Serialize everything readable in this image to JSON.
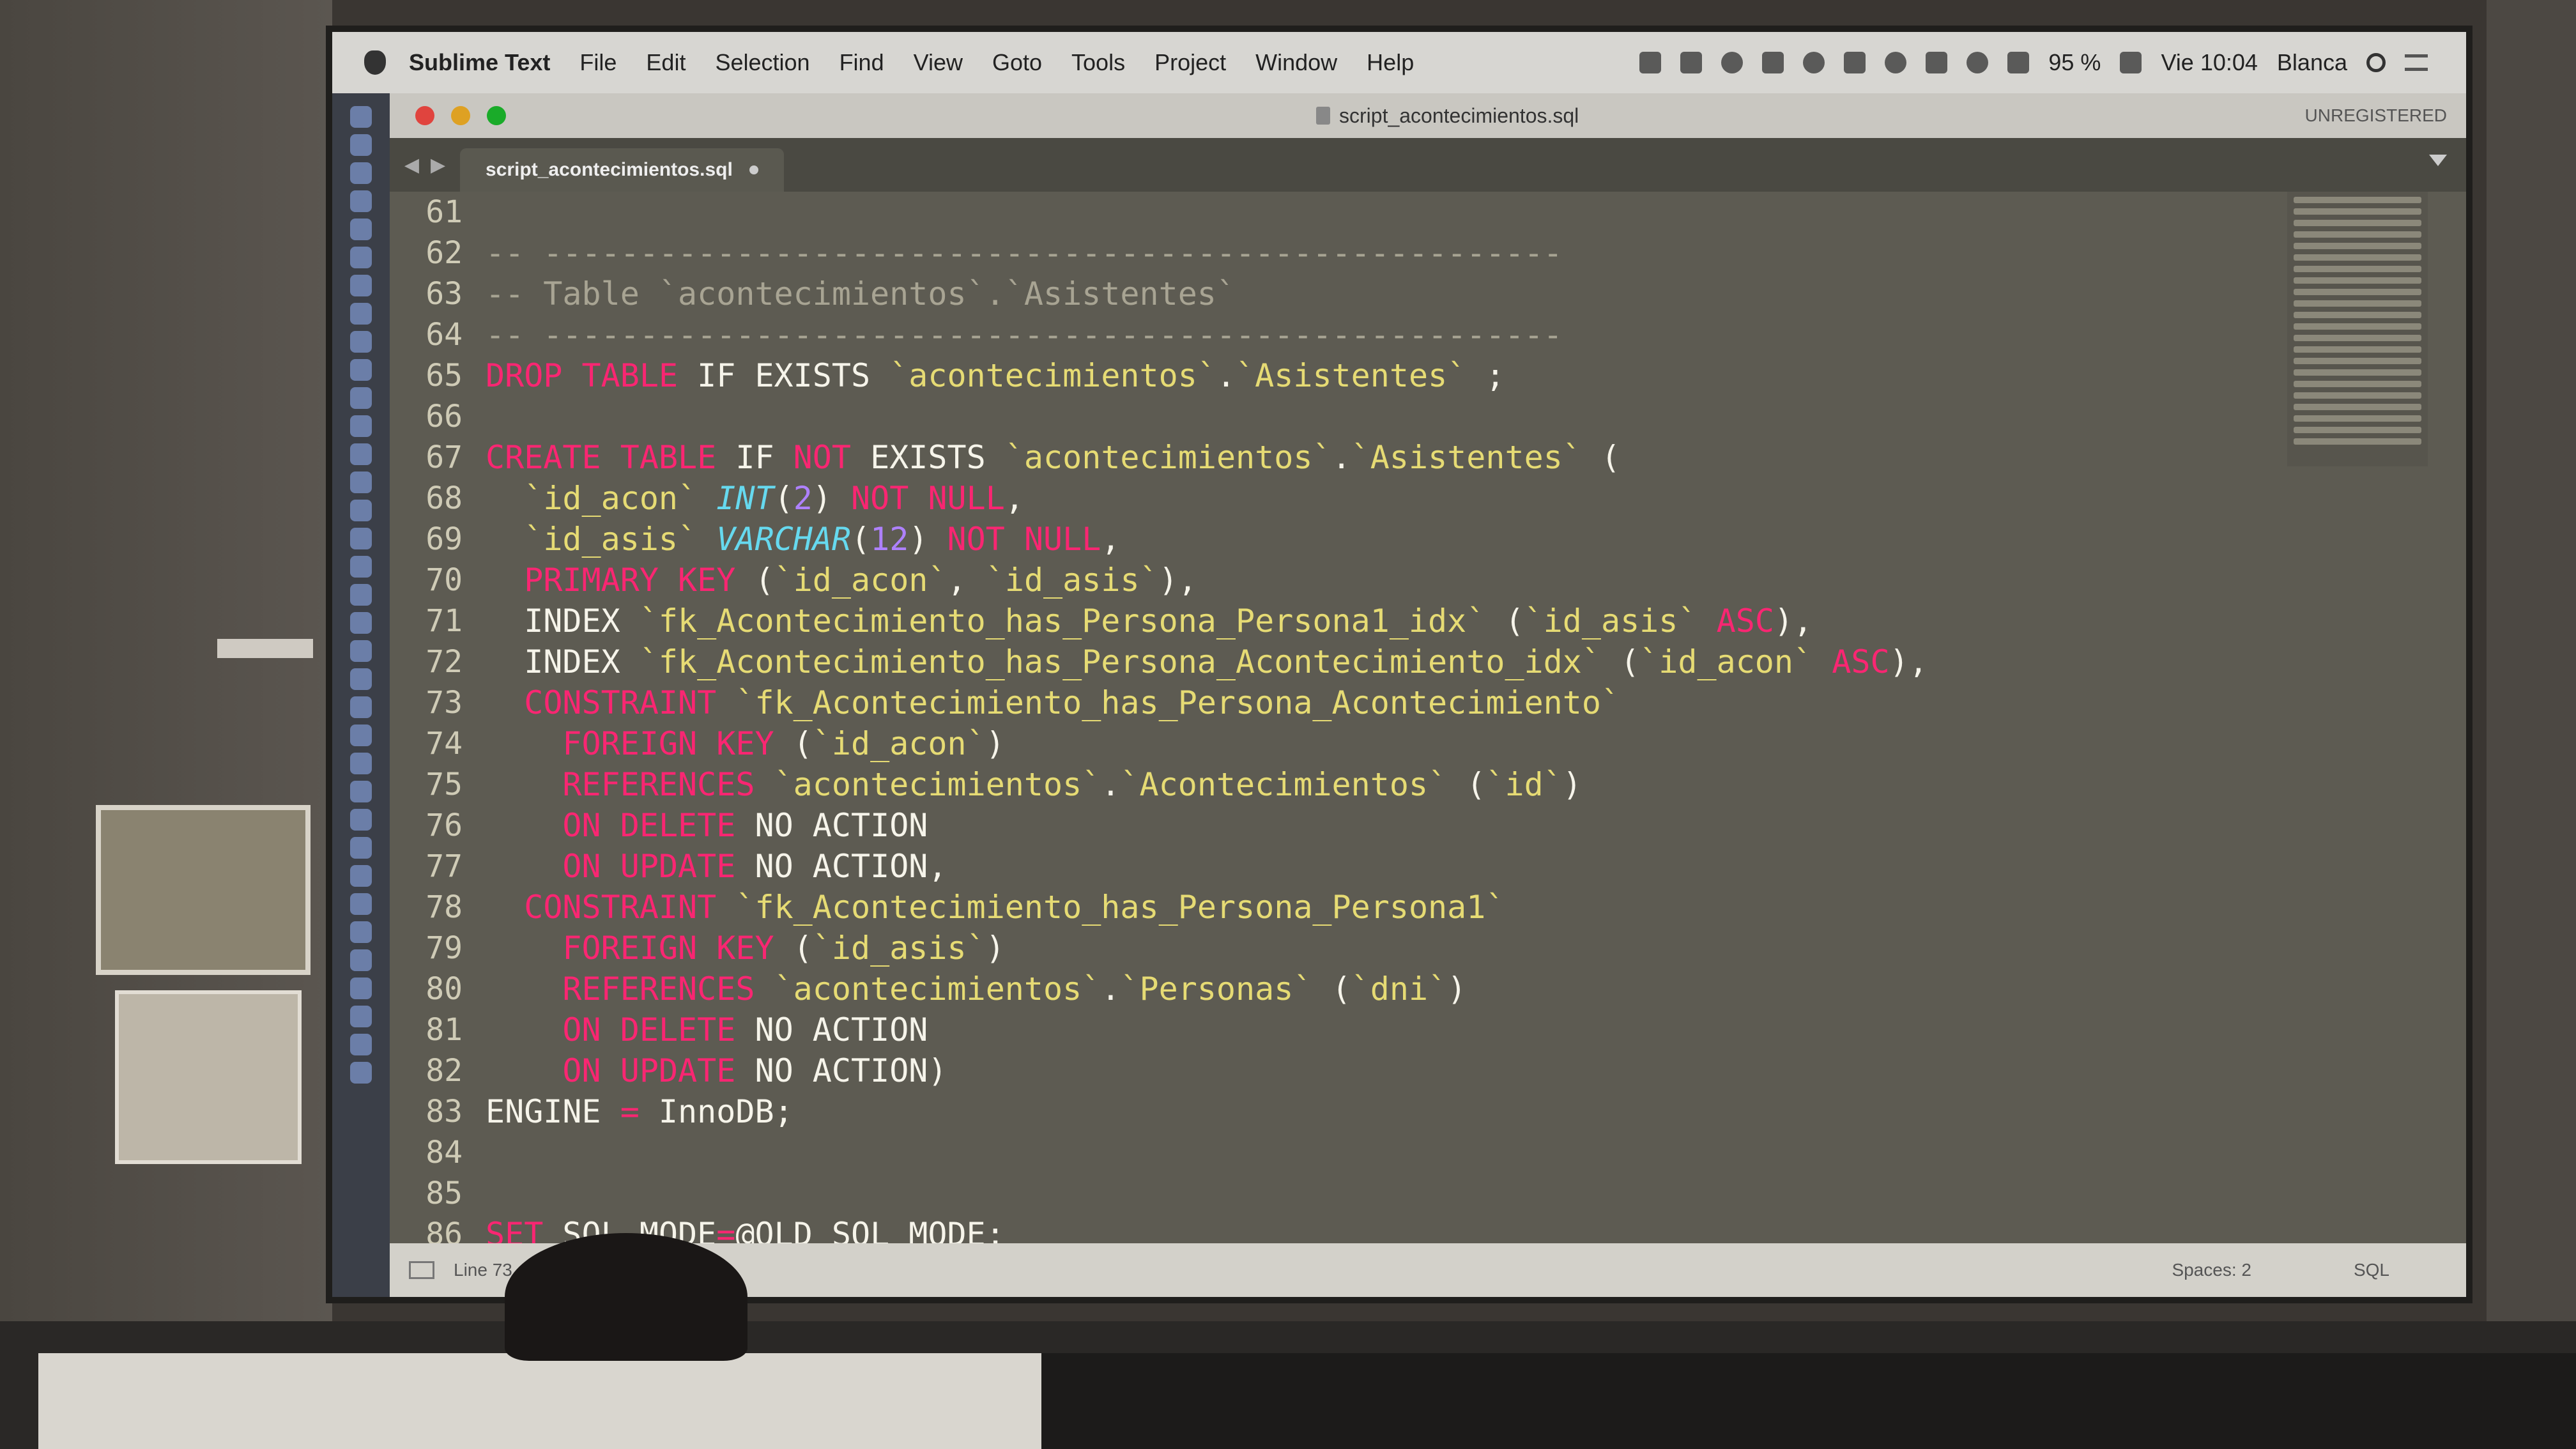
{
  "menubar": {
    "app_name": "Sublime Text",
    "menus": [
      "File",
      "Edit",
      "Selection",
      "Find",
      "View",
      "Goto",
      "Tools",
      "Project",
      "Window",
      "Help"
    ],
    "battery": "95 %",
    "clock": "Vie 10:04",
    "user": "Blanca"
  },
  "window": {
    "title": "script_acontecimientos.sql",
    "registration": "UNREGISTERED"
  },
  "tab": {
    "label": "script_acontecimientos.sql"
  },
  "editor": {
    "lines": [
      {
        "num": "61",
        "text": ""
      },
      {
        "num": "62",
        "text": "-- -----------------------------------------------------"
      },
      {
        "num": "63",
        "text": "-- Table `acontecimientos`.`Asistentes`"
      },
      {
        "num": "64",
        "text": "-- -----------------------------------------------------"
      },
      {
        "num": "65",
        "text": "DROP TABLE IF EXISTS `acontecimientos`.`Asistentes` ;"
      },
      {
        "num": "66",
        "text": ""
      },
      {
        "num": "67",
        "text": "CREATE TABLE IF NOT EXISTS `acontecimientos`.`Asistentes` ("
      },
      {
        "num": "68",
        "text": "  `id_acon` INT(2) NOT NULL,"
      },
      {
        "num": "69",
        "text": "  `id_asis` VARCHAR(12) NOT NULL,"
      },
      {
        "num": "70",
        "text": "  PRIMARY KEY (`id_acon`, `id_asis`),"
      },
      {
        "num": "71",
        "text": "  INDEX `fk_Acontecimiento_has_Persona_Persona1_idx` (`id_asis` ASC),"
      },
      {
        "num": "72",
        "text": "  INDEX `fk_Acontecimiento_has_Persona_Acontecimiento_idx` (`id_acon` ASC),"
      },
      {
        "num": "73",
        "text": "  CONSTRAINT `fk_Acontecimiento_has_Persona_Acontecimiento`"
      },
      {
        "num": "74",
        "text": "    FOREIGN KEY (`id_acon`)"
      },
      {
        "num": "75",
        "text": "    REFERENCES `acontecimientos`.`Acontecimientos` (`id`)"
      },
      {
        "num": "76",
        "text": "    ON DELETE NO ACTION"
      },
      {
        "num": "77",
        "text": "    ON UPDATE NO ACTION,"
      },
      {
        "num": "78",
        "text": "  CONSTRAINT `fk_Acontecimiento_has_Persona_Persona1`"
      },
      {
        "num": "79",
        "text": "    FOREIGN KEY (`id_asis`)"
      },
      {
        "num": "80",
        "text": "    REFERENCES `acontecimientos`.`Personas` (`dni`)"
      },
      {
        "num": "81",
        "text": "    ON DELETE NO ACTION"
      },
      {
        "num": "82",
        "text": "    ON UPDATE NO ACTION)"
      },
      {
        "num": "83",
        "text": "ENGINE = InnoDB;"
      },
      {
        "num": "84",
        "text": ""
      },
      {
        "num": "85",
        "text": ""
      },
      {
        "num": "86",
        "text": "SET SQL_MODE=@OLD_SQL_MODE;"
      }
    ]
  },
  "statusbar": {
    "position": "Line 73, C",
    "indent": "Spaces: 2",
    "syntax": "SQL"
  },
  "colors": {
    "keyword": "#f92672",
    "string": "#e6db74",
    "type": "#66d9ef",
    "number": "#ae81ff",
    "comment": "#a8a493",
    "background": "#5d5b52"
  }
}
